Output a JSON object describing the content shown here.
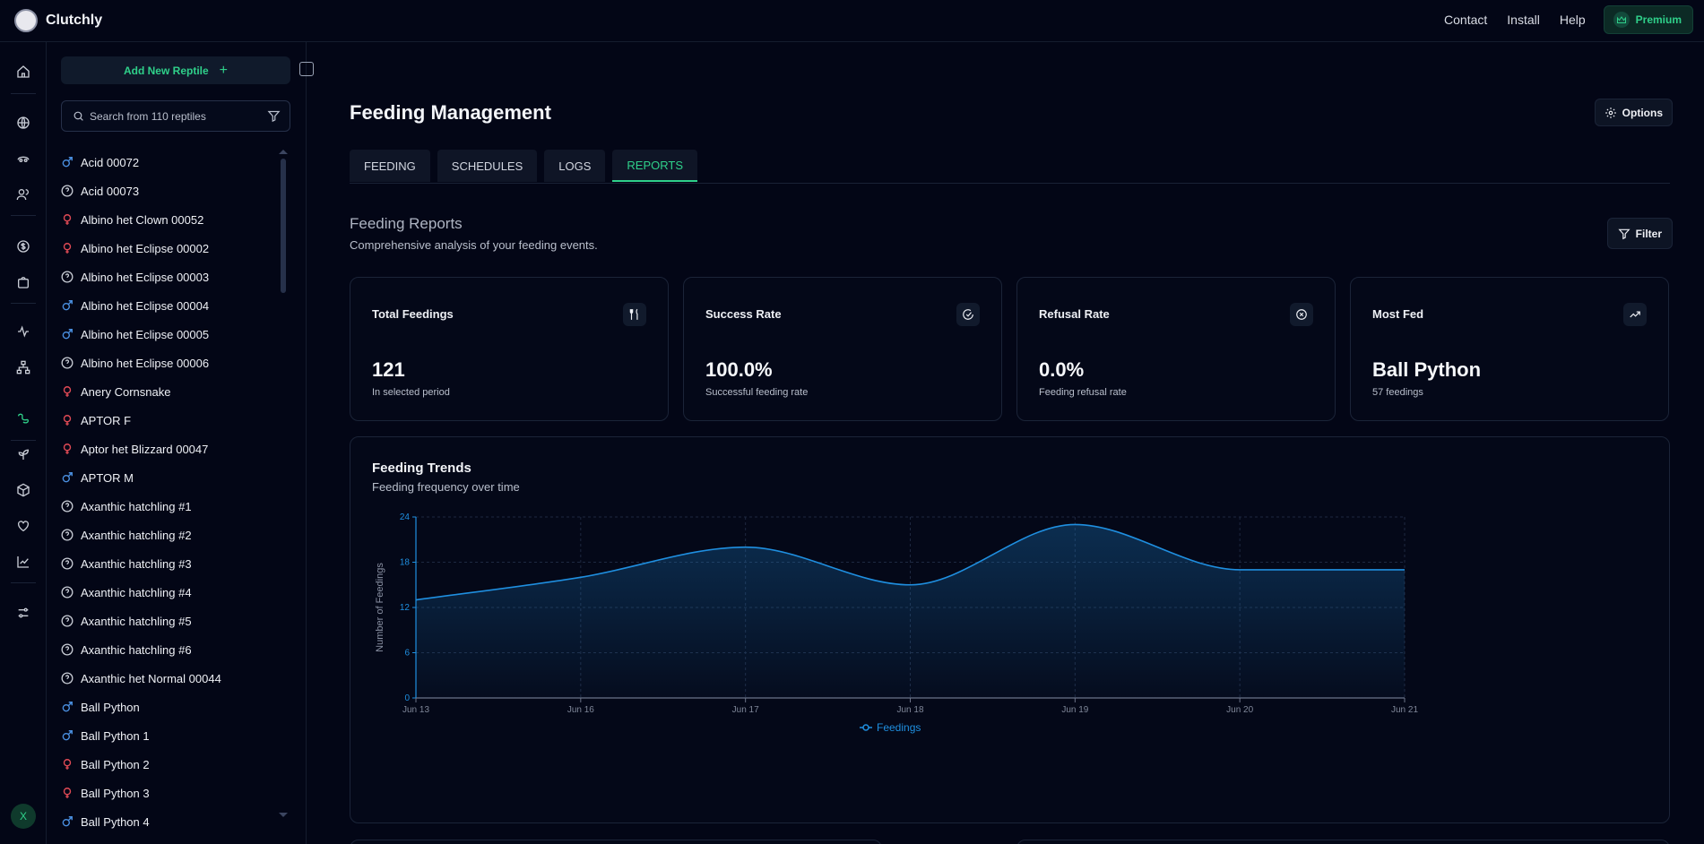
{
  "app": {
    "name": "Clutchly",
    "logo_text": "Clutchly"
  },
  "topnav": {
    "contact": "Contact",
    "install": "Install",
    "help": "Help",
    "premium": "Premium"
  },
  "rail": [
    "home-icon",
    "globe-icon",
    "reptile-icon",
    "users-icon",
    "dollar-icon",
    "bag-icon",
    "activity-icon",
    "tree-icon",
    "feeding-icon",
    "plant-icon",
    "box-icon",
    "heart-icon",
    "chart-icon",
    "sliders-icon"
  ],
  "user": {
    "initial": "X"
  },
  "sidebar": {
    "add_label": "Add New Reptile",
    "search_placeholder": "Search from 110 reptiles",
    "reptiles": [
      {
        "name": "Acid 00072",
        "sex": "male"
      },
      {
        "name": "Acid 00073",
        "sex": "unknown"
      },
      {
        "name": "Albino het Clown 00052",
        "sex": "female"
      },
      {
        "name": "Albino het Eclipse 00002",
        "sex": "female"
      },
      {
        "name": "Albino het Eclipse 00003",
        "sex": "unknown"
      },
      {
        "name": "Albino het Eclipse 00004",
        "sex": "male"
      },
      {
        "name": "Albino het Eclipse 00005",
        "sex": "male"
      },
      {
        "name": "Albino het Eclipse 00006",
        "sex": "unknown"
      },
      {
        "name": "Anery Cornsnake",
        "sex": "female"
      },
      {
        "name": "APTOR F",
        "sex": "female"
      },
      {
        "name": "Aptor het Blizzard 00047",
        "sex": "female"
      },
      {
        "name": "APTOR M",
        "sex": "male"
      },
      {
        "name": "Axanthic hatchling #1",
        "sex": "unknown"
      },
      {
        "name": "Axanthic hatchling #2",
        "sex": "unknown"
      },
      {
        "name": "Axanthic hatchling #3",
        "sex": "unknown"
      },
      {
        "name": "Axanthic hatchling #4",
        "sex": "unknown"
      },
      {
        "name": "Axanthic hatchling #5",
        "sex": "unknown"
      },
      {
        "name": "Axanthic hatchling #6",
        "sex": "unknown"
      },
      {
        "name": "Axanthic het Normal 00044",
        "sex": "unknown"
      },
      {
        "name": "Ball Python",
        "sex": "male"
      },
      {
        "name": "Ball Python 1",
        "sex": "male"
      },
      {
        "name": "Ball Python 2",
        "sex": "female"
      },
      {
        "name": "Ball Python 3",
        "sex": "female"
      },
      {
        "name": "Ball Python 4",
        "sex": "male"
      }
    ]
  },
  "main": {
    "title": "Feeding Management",
    "options_label": "Options",
    "tabs": [
      "FEEDING",
      "SCHEDULES",
      "LOGS",
      "REPORTS"
    ],
    "active_tab": "REPORTS",
    "section_title": "Feeding Reports",
    "section_subtitle": "Comprehensive analysis of your feeding events.",
    "filter_label": "Filter",
    "stats": [
      {
        "label": "Total Feedings",
        "value": "121",
        "caption": "In selected period",
        "icon": "utensils-icon"
      },
      {
        "label": "Success Rate",
        "value": "100.0%",
        "caption": "Successful feeding rate",
        "icon": "check-circle-icon"
      },
      {
        "label": "Refusal Rate",
        "value": "0.0%",
        "caption": "Feeding refusal rate",
        "icon": "x-circle-icon"
      },
      {
        "label": "Most Fed",
        "value": "Ball Python",
        "caption": "57 feedings",
        "icon": "trending-up-icon"
      }
    ],
    "chart_title": "Feeding Trends",
    "chart_subtitle": "Feeding frequency over time"
  },
  "colors": {
    "accent": "#2fd08a",
    "male": "#4a8fe0",
    "female": "#e04a55",
    "unknown": "#c9cdd6",
    "line": "#1f8fe0",
    "bg": "#030616"
  },
  "chart_data": {
    "type": "area",
    "categories": [
      "Jun 13",
      "Jun 16",
      "Jun 17",
      "Jun 18",
      "Jun 19",
      "Jun 20",
      "Jun 21"
    ],
    "series": [
      {
        "name": "Feedings",
        "values": [
          13,
          16,
          20,
          15,
          23,
          17,
          17
        ]
      }
    ],
    "ylabel": "Number of Feedings",
    "yticks": [
      0,
      6,
      12,
      18,
      24
    ],
    "ylim": [
      0,
      24
    ],
    "grid": true,
    "legend": "bottom-center"
  }
}
